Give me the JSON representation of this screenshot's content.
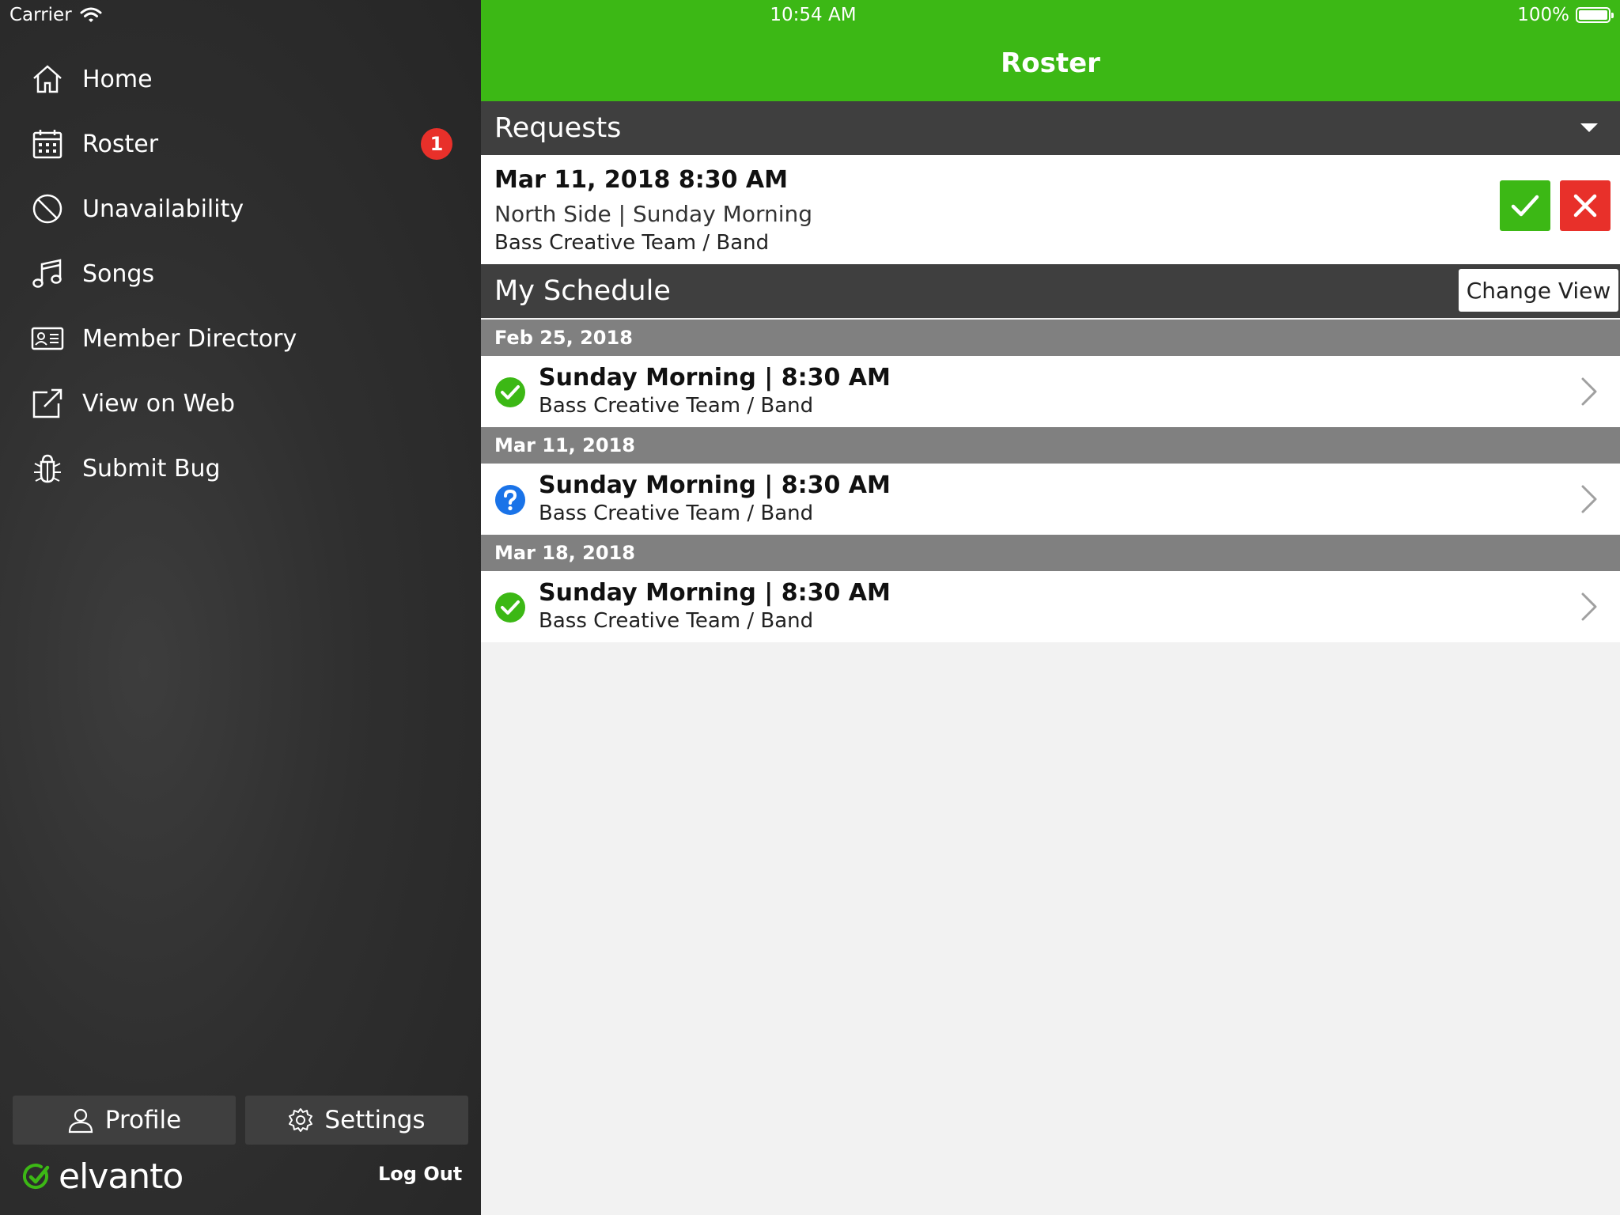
{
  "status_bar": {
    "carrier": "Carrier",
    "time": "10:54 AM",
    "battery": "100%"
  },
  "sidebar": {
    "items": [
      {
        "label": "Home",
        "icon": "home-icon"
      },
      {
        "label": "Roster",
        "icon": "calendar-icon",
        "badge": "1"
      },
      {
        "label": "Unavailability",
        "icon": "block-icon"
      },
      {
        "label": "Songs",
        "icon": "music-note-icon"
      },
      {
        "label": "Member Directory",
        "icon": "id-card-icon"
      },
      {
        "label": "View on Web",
        "icon": "external-link-icon"
      },
      {
        "label": "Submit Bug",
        "icon": "bug-icon"
      }
    ],
    "profile_label": "Profile",
    "settings_label": "Settings",
    "logo_text": "elvanto",
    "logout_label": "Log Out"
  },
  "header": {
    "title": "Roster"
  },
  "requests": {
    "title": "Requests",
    "item": {
      "date": "Mar 11, 2018 8:30 AM",
      "location": "North Side | Sunday Morning",
      "team": "Bass Creative Team / Band"
    }
  },
  "schedule": {
    "title": "My Schedule",
    "change_view_label": "Change View",
    "groups": [
      {
        "date": "Feb 25, 2018",
        "title": "Sunday Morning | 8:30 AM",
        "subtitle": "Bass Creative Team / Band",
        "status": "confirmed"
      },
      {
        "date": "Mar 11, 2018",
        "title": "Sunday Morning | 8:30 AM",
        "subtitle": "Bass Creative Team / Band",
        "status": "pending"
      },
      {
        "date": "Mar 18, 2018",
        "title": "Sunday Morning | 8:30 AM",
        "subtitle": "Bass Creative Team / Band",
        "status": "confirmed"
      }
    ]
  },
  "colors": {
    "accent": "#3cb815",
    "decline": "#e8302a",
    "pending": "#1a73e8",
    "header_dark": "#3f3f3f",
    "divider": "#808080"
  }
}
